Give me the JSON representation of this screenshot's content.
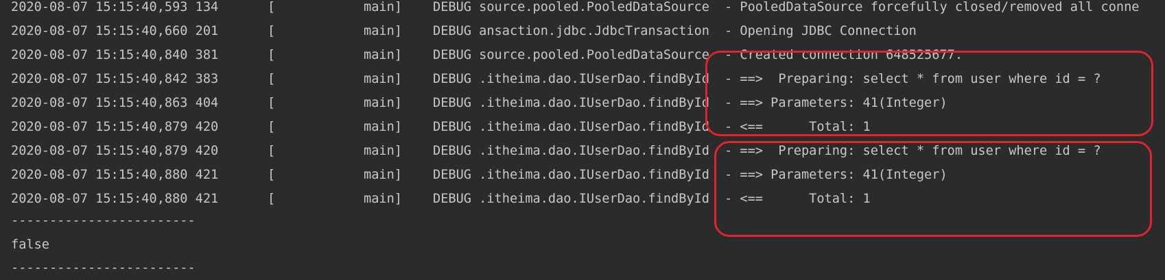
{
  "log_lines": [
    {
      "ts": "2020-08-07 15:15:40,593 134",
      "bracket": "[",
      "thread": "main]",
      "level": "DEBUG",
      "logger": "source.pooled.PooledDataSource",
      "message": "- PooledDataSource forcefully closed/removed all conne"
    },
    {
      "ts": "2020-08-07 15:15:40,660 201",
      "bracket": "[",
      "thread": "main]",
      "level": "DEBUG",
      "logger": "ansaction.jdbc.JdbcTransaction",
      "message": "- Opening JDBC Connection"
    },
    {
      "ts": "2020-08-07 15:15:40,840 381",
      "bracket": "[",
      "thread": "main]",
      "level": "DEBUG",
      "logger": "source.pooled.PooledDataSource",
      "message": "- Created connection 648525677."
    },
    {
      "ts": "2020-08-07 15:15:40,842 383",
      "bracket": "[",
      "thread": "main]",
      "level": "DEBUG",
      "logger": ".itheima.dao.IUserDao.findById",
      "message": "- ==>  Preparing: select * from user where id = ?"
    },
    {
      "ts": "2020-08-07 15:15:40,863 404",
      "bracket": "[",
      "thread": "main]",
      "level": "DEBUG",
      "logger": ".itheima.dao.IUserDao.findById",
      "message": "- ==> Parameters: 41(Integer)"
    },
    {
      "ts": "2020-08-07 15:15:40,879 420",
      "bracket": "[",
      "thread": "main]",
      "level": "DEBUG",
      "logger": ".itheima.dao.IUserDao.findById",
      "message": "- <==      Total: 1"
    },
    {
      "ts": "2020-08-07 15:15:40,879 420",
      "bracket": "[",
      "thread": "main]",
      "level": "DEBUG",
      "logger": ".itheima.dao.IUserDao.findById",
      "message": "- ==>  Preparing: select * from user where id = ?"
    },
    {
      "ts": "2020-08-07 15:15:40,880 421",
      "bracket": "[",
      "thread": "main]",
      "level": "DEBUG",
      "logger": ".itheima.dao.IUserDao.findById",
      "message": "- ==> Parameters: 41(Integer)"
    },
    {
      "ts": "2020-08-07 15:15:40,880 421",
      "bracket": "[",
      "thread": "main]",
      "level": "DEBUG",
      "logger": ".itheima.dao.IUserDao.findById",
      "message": "- <==      Total: 1"
    }
  ],
  "separator_top": "------------------------",
  "result": "false",
  "separator_bottom": "------------------------",
  "colors": {
    "background": "#2b2b2b",
    "text": "#c8c8c8",
    "annotation": "#e0242d"
  }
}
